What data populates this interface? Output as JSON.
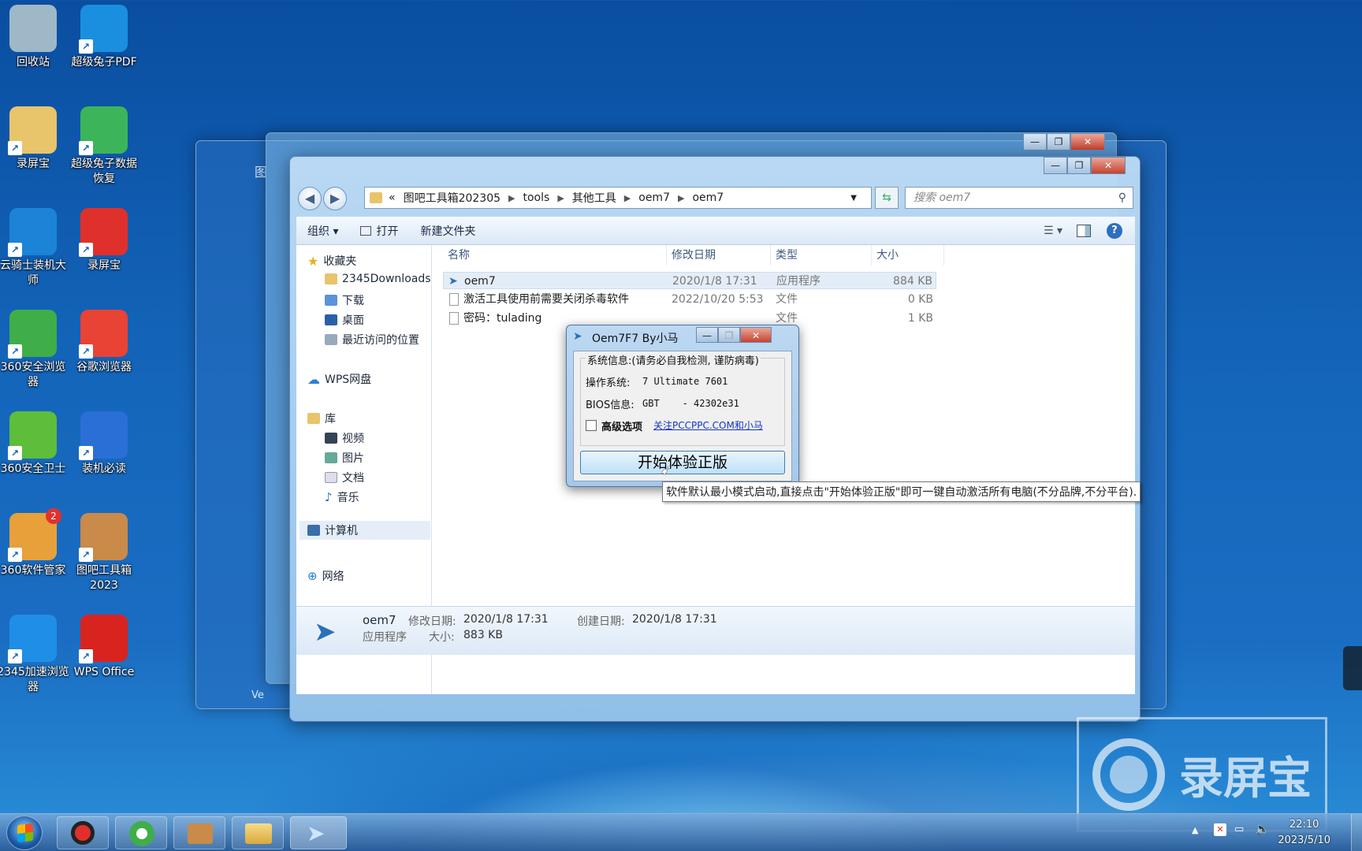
{
  "desktop": {
    "icons": [
      {
        "label": "回收站",
        "icon": "recycle-bin-icon",
        "color": "#9fb8c8"
      },
      {
        "label": "超级兔子PDF",
        "icon": "pdf-app-icon",
        "color": "#1a8fe0"
      },
      {
        "label": "录屏宝",
        "icon": "folder-icon",
        "color": "#e8c46a"
      },
      {
        "label": "超级兔子数据恢复",
        "icon": "rabbit-icon",
        "color": "#3cb55a"
      },
      {
        "label": "云骑士装机大师",
        "icon": "knight-icon",
        "color": "#1b84d6"
      },
      {
        "label": "录屏宝",
        "icon": "record-icon",
        "color": "#e0302b"
      },
      {
        "label": "360安全浏览器",
        "icon": "360-browser-icon",
        "color": "#3fae48"
      },
      {
        "label": "谷歌浏览器",
        "icon": "chrome-icon",
        "color": "#e84335"
      },
      {
        "label": "360安全卫士",
        "icon": "360-guard-icon",
        "color": "#5ebd3a"
      },
      {
        "label": "装机必读",
        "icon": "word-doc-icon",
        "color": "#2a6fd6"
      },
      {
        "label": "360软件管家",
        "icon": "360-manager-icon",
        "color": "#e8a03a"
      },
      {
        "label": "图吧工具箱2023",
        "icon": "toolbox-icon",
        "color": "#c98a4a"
      },
      {
        "label": "2345加速浏览器",
        "icon": "2345-browser-icon",
        "color": "#1f8ee6"
      },
      {
        "label": "WPS Office",
        "icon": "wps-icon",
        "color": "#d9231f"
      }
    ],
    "badge_360_manager": "2"
  },
  "back_window": {
    "partial_label": "图",
    "partial_footer": "Ve"
  },
  "explorer": {
    "window_buttons": [
      "—",
      "❐",
      "✕"
    ],
    "breadcrumb": [
      "«",
      "图吧工具箱202305",
      "tools",
      "其他工具",
      "oem7",
      "oem7"
    ],
    "search_placeholder": "搜索 oem7",
    "toolbar": {
      "organize": "组织 ▾",
      "open": "打开",
      "new_folder": "新建文件夹"
    },
    "nav": {
      "favorites": "收藏夹",
      "fav_items": [
        "2345Downloads",
        "下载",
        "桌面",
        "最近访问的位置"
      ],
      "wps": "WPS网盘",
      "libraries": "库",
      "lib_items": [
        "视频",
        "图片",
        "文档",
        "音乐"
      ],
      "computer": "计算机",
      "network": "网络"
    },
    "columns": {
      "name": "名称",
      "date": "修改日期",
      "type": "类型",
      "size": "大小"
    },
    "files": [
      {
        "name": "oem7",
        "date": "2020/1/8 17:31",
        "type": "应用程序",
        "size": "884 KB"
      },
      {
        "name": "激活工具使用前需要关闭杀毒软件",
        "date": "2022/10/20 5:53",
        "type": "文件",
        "size": "0 KB"
      },
      {
        "name": "密码：tulading",
        "date": "",
        "type": "文件",
        "size": "1 KB"
      }
    ],
    "details": {
      "name": "oem7",
      "kind": "应用程序",
      "modified_label": "修改日期:",
      "modified": "2020/1/8 17:31",
      "created_label": "创建日期:",
      "created": "2020/1/8 17:31",
      "size_label": "大小:",
      "size": "883 KB"
    }
  },
  "oem_dialog": {
    "title": "Oem7F7 By小马",
    "group_title": "系统信息:(请务必自我检测, 谨防病毒)",
    "os_label": "操作系统:",
    "os_value": "7 Ultimate 7601",
    "bios_label": "BIOS信息:",
    "bios_value": "GBT    - 42302e31",
    "advanced": "高级选项",
    "link": "关注PCCPPC.COM和小马",
    "start_button": "开始体验正版",
    "tooltip": "软件默认最小模式启动,直接点击\"开始体验正版\"即可一键自动激活所有电脑(不分品牌,不分平台)."
  },
  "watermark": "录屏宝",
  "taskbar": {
    "apps": [
      "record-icon",
      "360-browser-icon",
      "toolbox-icon",
      "folder-icon",
      "oem7-icon"
    ],
    "time": "22:10",
    "date": "2023/5/10"
  }
}
